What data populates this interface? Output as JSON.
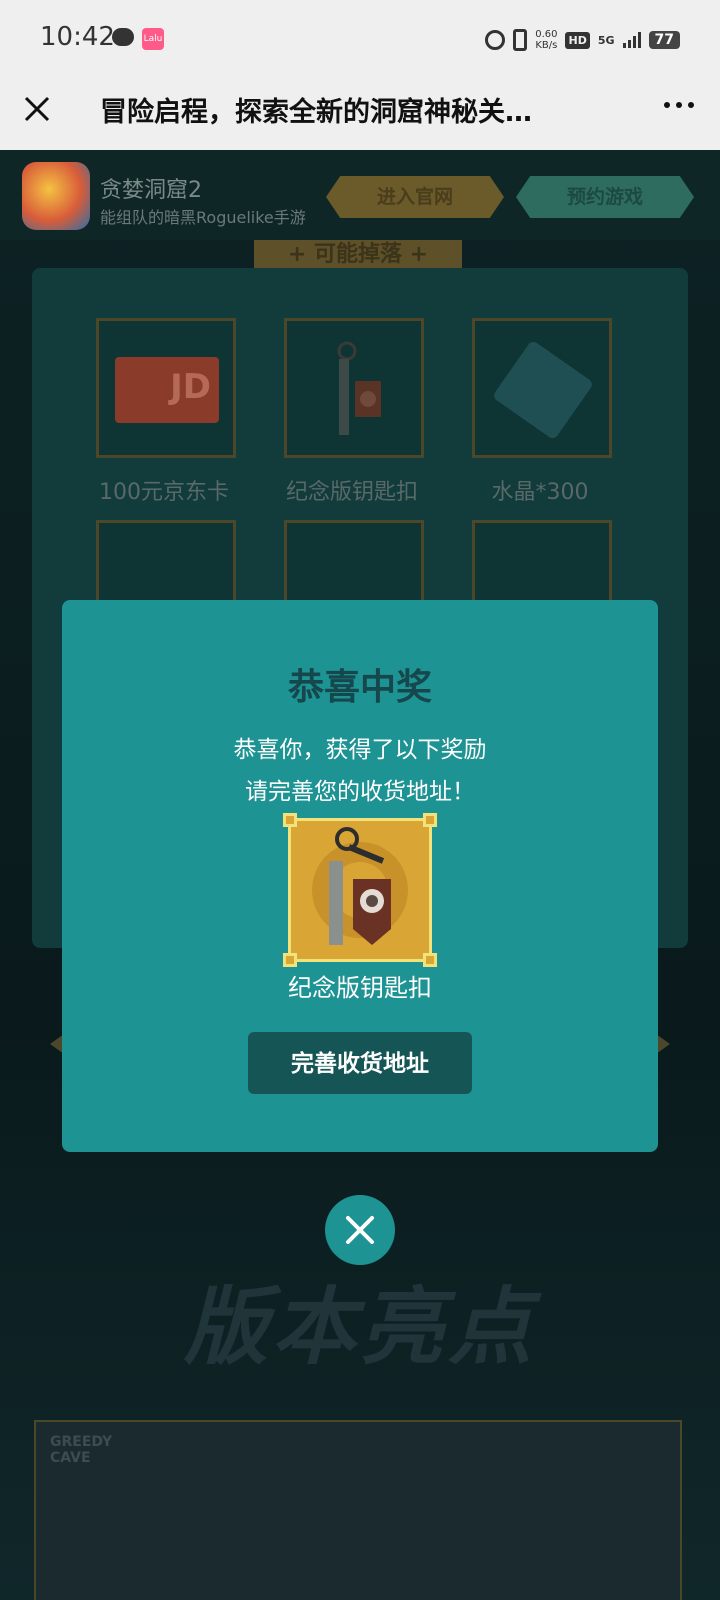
{
  "status_bar": {
    "time": "10:42",
    "network_speed_value": "0.60",
    "network_speed_unit": "KB/s",
    "hd": "HD",
    "signal": "5G",
    "battery": "77",
    "app_badge": "Lalu"
  },
  "title_bar": {
    "title": "冒险启程，探索全新的洞窟神秘关…"
  },
  "game": {
    "name": "贪婪洞窟2",
    "subtitle": "能组队的暗黑Roguelike手游",
    "official_button": "进入官网",
    "reserve_button": "预约游戏"
  },
  "drops": {
    "tag": "+ 可能掉落 +",
    "items": [
      {
        "label": "100元京东卡"
      },
      {
        "label": "纪念版钥匙扣"
      },
      {
        "label": "水晶*300"
      }
    ],
    "jd_text": "JD"
  },
  "section": {
    "title": "版本亮点"
  },
  "preview": {
    "logo_text": "GREEDY CAVE"
  },
  "modal": {
    "title": "恭喜中奖",
    "line1": "恭喜你，获得了以下奖励",
    "line2": "请完善您的收货地址！",
    "prize_label": "纪念版钥匙扣",
    "button": "完善收货地址"
  },
  "colors": {
    "modal_bg": "#1e9393",
    "modal_title": "#15474d",
    "button_bg": "#155556",
    "prize_bg": "#d9a535"
  }
}
